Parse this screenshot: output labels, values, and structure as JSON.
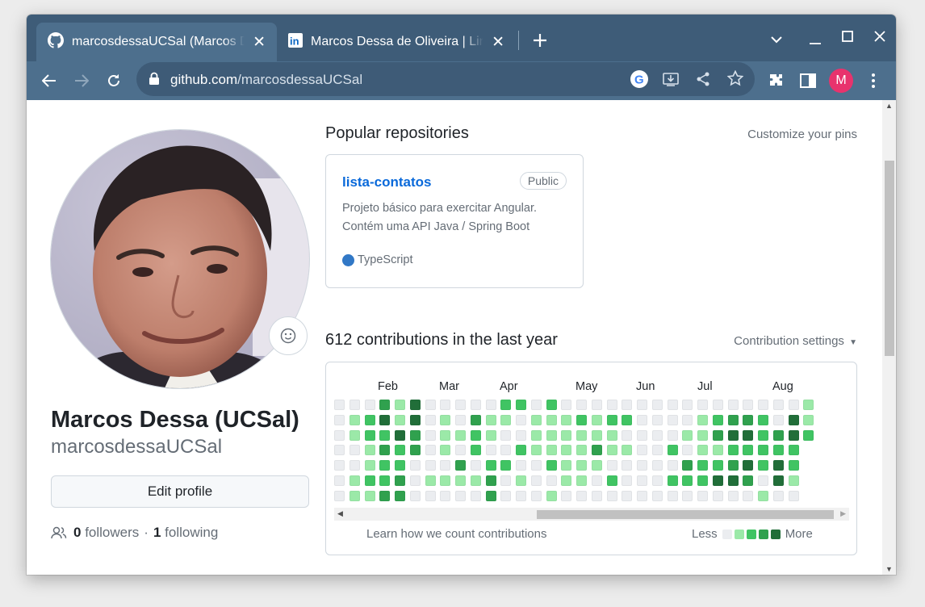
{
  "browser": {
    "tabs": [
      {
        "title": "marcosdessaUCSal (Marcos Dessa)",
        "icon": "github-icon",
        "active": true
      },
      {
        "title": "Marcos Dessa de Oliveira | LinkedIn",
        "icon": "linkedin-icon",
        "active": false
      }
    ],
    "url_host": "github.com",
    "url_path": "/marcosdessaUCSal",
    "profile_initial": "M",
    "colors": {
      "tabstrip": "#3e5c78",
      "toolbar": "#4d6f8d",
      "profile": "#e8336d"
    }
  },
  "profile": {
    "name": "Marcos Dessa (UCSal)",
    "login": "marcosdessaUCSal",
    "edit_button": "Edit profile",
    "followers_count": "0",
    "followers_label": "followers",
    "separator": "·",
    "following_count": "1",
    "following_label": "following"
  },
  "popular": {
    "title": "Popular repositories",
    "customize_link": "Customize your pins",
    "repos": [
      {
        "name": "lista-contatos",
        "visibility": "Public",
        "description": "Projeto básico para exercitar Angular. Contém uma API Java / Spring Boot",
        "language": "TypeScript",
        "language_color": "#3178c6"
      }
    ]
  },
  "contributions": {
    "title": "612 contributions in the last year",
    "settings_label": "Contribution settings",
    "months": [
      "Feb",
      "Mar",
      "Apr",
      "May",
      "Jun",
      "Jul",
      "Aug"
    ],
    "learn_link": "Learn how we count contributions",
    "legend_less": "Less",
    "legend_more": "More",
    "level_colors": [
      "#ebedf0",
      "#9be9a8",
      "#40c463",
      "#30a14e",
      "#216e39"
    ],
    "grid": [
      [
        0,
        0,
        0,
        0,
        0,
        0,
        0
      ],
      [
        0,
        1,
        1,
        0,
        0,
        1,
        1
      ],
      [
        0,
        2,
        2,
        1,
        1,
        2,
        1
      ],
      [
        3,
        4,
        2,
        3,
        2,
        2,
        3
      ],
      [
        1,
        1,
        4,
        2,
        2,
        3,
        3
      ],
      [
        4,
        4,
        3,
        3,
        0,
        0,
        0
      ],
      [
        0,
        0,
        0,
        0,
        0,
        1,
        0
      ],
      [
        0,
        1,
        1,
        1,
        0,
        1,
        0
      ],
      [
        0,
        0,
        1,
        0,
        3,
        1,
        0
      ],
      [
        0,
        3,
        2,
        2,
        0,
        1,
        0
      ],
      [
        0,
        1,
        1,
        0,
        2,
        3,
        3
      ],
      [
        2,
        1,
        0,
        0,
        2,
        0,
        0
      ],
      [
        2,
        0,
        0,
        2,
        0,
        1,
        0
      ],
      [
        0,
        1,
        1,
        1,
        0,
        0,
        0
      ],
      [
        2,
        1,
        1,
        1,
        2,
        0,
        1
      ],
      [
        0,
        1,
        1,
        1,
        1,
        1,
        0
      ],
      [
        0,
        2,
        1,
        1,
        1,
        1,
        0
      ],
      [
        0,
        1,
        1,
        3,
        1,
        0,
        0
      ],
      [
        0,
        2,
        1,
        1,
        0,
        2,
        0
      ],
      [
        0,
        2,
        0,
        1,
        0,
        0,
        0
      ],
      [
        0,
        0,
        0,
        0,
        0,
        0,
        0
      ],
      [
        0,
        0,
        0,
        0,
        0,
        0,
        0
      ],
      [
        0,
        0,
        0,
        2,
        0,
        2,
        0
      ],
      [
        0,
        0,
        1,
        0,
        3,
        2,
        0
      ],
      [
        0,
        1,
        1,
        1,
        2,
        2,
        0
      ],
      [
        0,
        2,
        3,
        1,
        2,
        4,
        0
      ],
      [
        0,
        3,
        4,
        2,
        3,
        4,
        0
      ],
      [
        0,
        3,
        4,
        2,
        4,
        3,
        0
      ],
      [
        0,
        2,
        2,
        2,
        2,
        0,
        1
      ],
      [
        0,
        0,
        3,
        2,
        4,
        4,
        0
      ],
      [
        0,
        4,
        4,
        2,
        2,
        1,
        0
      ],
      [
        1,
        1,
        2,
        null,
        null,
        null,
        null
      ]
    ]
  }
}
